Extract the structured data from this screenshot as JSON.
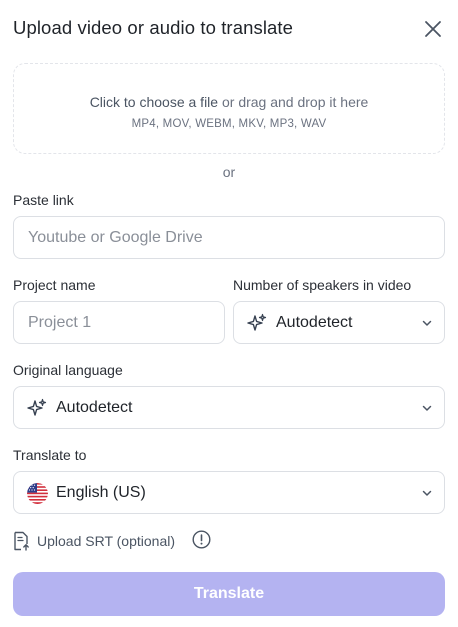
{
  "dialog": {
    "title": "Upload video or audio to translate"
  },
  "dropzone": {
    "choose_text": "Click to choose a file",
    "drag_text": " or drag and drop it here",
    "formats": "MP4, MOV, WEBM, MKV, MP3, WAV"
  },
  "or_text": "or",
  "paste_link": {
    "label": "Paste link",
    "placeholder": "Youtube or Google Drive",
    "value": ""
  },
  "project_name": {
    "label": "Project name",
    "placeholder": "Project 1",
    "value": ""
  },
  "speakers": {
    "label": "Number of speakers in video",
    "value": "Autodetect",
    "icon": "sparkles-icon"
  },
  "original_language": {
    "label": "Original language",
    "value": "Autodetect",
    "icon": "sparkles-icon"
  },
  "translate_to": {
    "label": "Translate to",
    "value": "English (US)",
    "icon": "us-flag-icon"
  },
  "srt": {
    "label": "Upload SRT (optional)"
  },
  "translate_button": {
    "label": "Translate"
  },
  "colors": {
    "primary_disabled": "#b4b3f1",
    "border": "#dcdfe4"
  }
}
